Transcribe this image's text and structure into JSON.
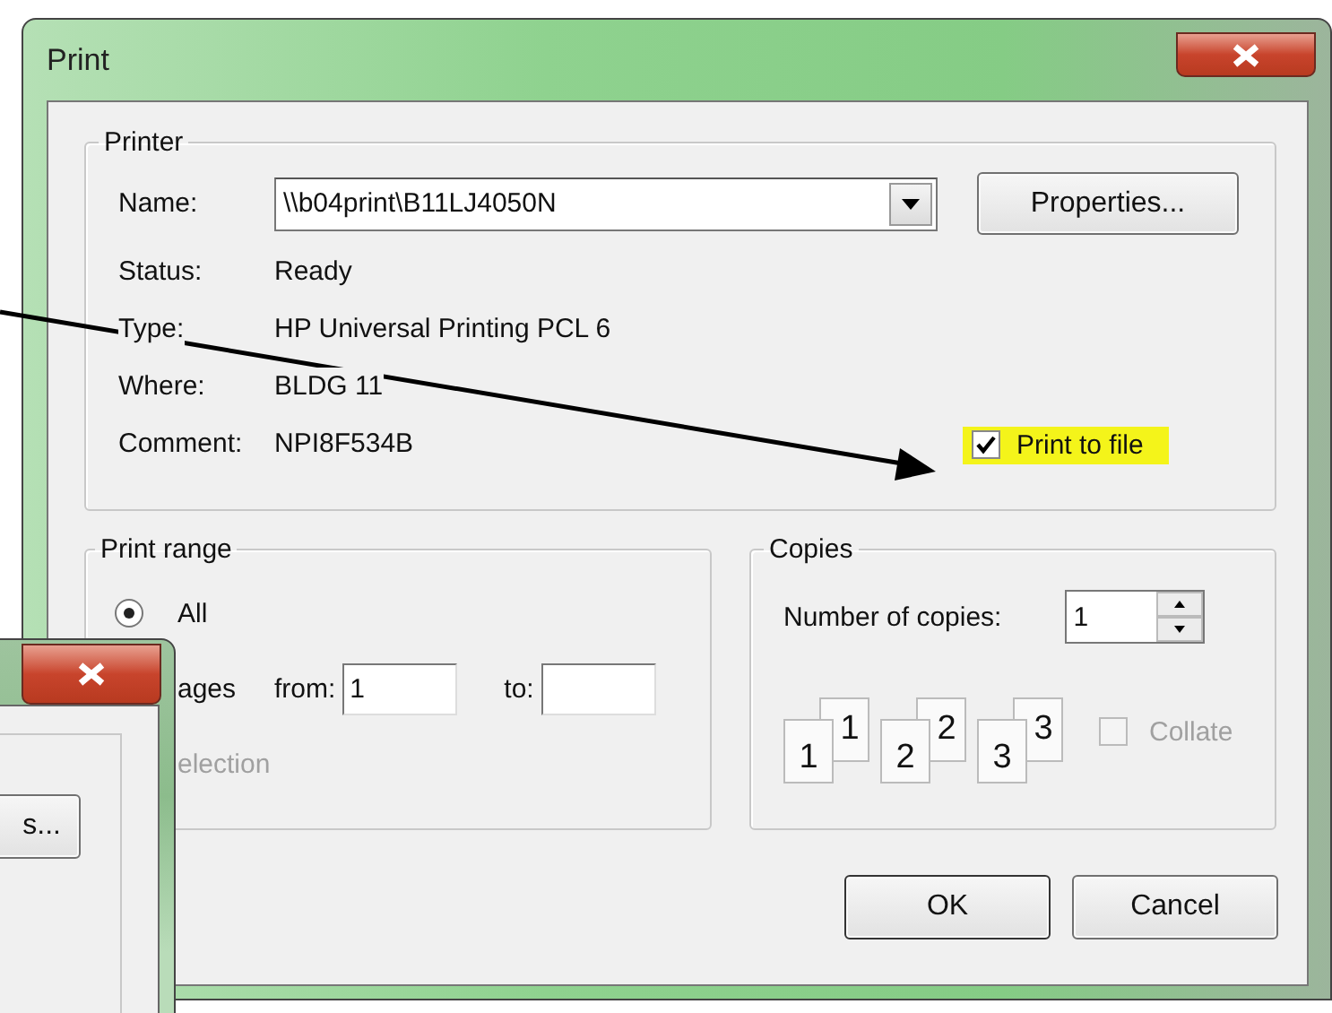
{
  "window": {
    "title": "Print"
  },
  "printer": {
    "group_title": "Printer",
    "name_label": "Name:",
    "name_value": "\\\\b04print\\B11LJ4050N",
    "properties_button": "Properties...",
    "info": [
      {
        "label": "Status:",
        "value": "Ready"
      },
      {
        "label": "Type:",
        "value": "HP Universal Printing PCL 6"
      },
      {
        "label": "Where:",
        "value": "BLDG 11"
      },
      {
        "label": "Comment:",
        "value": "NPI8F534B"
      }
    ],
    "print_to_file": {
      "label": "Print to file",
      "checked": true,
      "highlighted": true
    }
  },
  "print_range": {
    "group_title": "Print range",
    "all_option": {
      "label": "All",
      "selected": true
    },
    "pages_label": "ages",
    "selection_option": {
      "label": "election",
      "disabled": true
    },
    "from_label": "from:",
    "from_value": "1",
    "to_label": "to:"
  },
  "copies": {
    "group_title": "Copies",
    "number_label": "Number of copies:",
    "number_value": "1",
    "collate_preview": [
      {
        "front": "1",
        "back": "1"
      },
      {
        "front": "2",
        "back": "2"
      },
      {
        "front": "3",
        "back": "3"
      }
    ],
    "collate": {
      "label": "Collate",
      "checked": false,
      "disabled": true
    }
  },
  "buttons": [
    "OK",
    "Cancel"
  ],
  "background_window": {
    "button_text": "s..."
  }
}
